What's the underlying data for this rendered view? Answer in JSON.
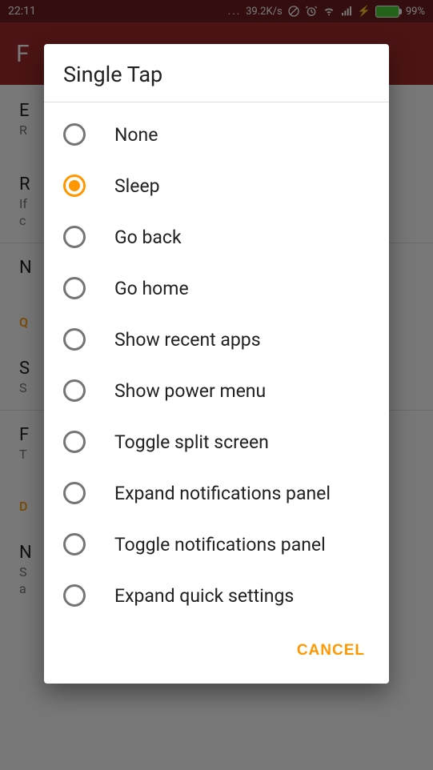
{
  "statusbar": {
    "time": "22:11",
    "net_speed": "39.2K/s",
    "battery_pct": "99%"
  },
  "background": {
    "actionbar_title_initial": "F",
    "rows": [
      {
        "hdr_initial": "E",
        "sub_initial": "R"
      },
      {
        "hdr_initial": "R",
        "sub_initial_line1": "If",
        "sub_initial_line2": "c"
      }
    ],
    "row_n": {
      "hdr_initial": "N"
    },
    "section_q": "Q",
    "row_s": {
      "hdr_initial": "S",
      "sub_initial": "S"
    },
    "row_f": {
      "hdr_initial": "F",
      "sub_initial": "T"
    },
    "section_d": "D",
    "row_bottom": {
      "hdr_initial": "N",
      "sub_initial_line1": "S",
      "sub_initial_line2": "a"
    }
  },
  "dialog": {
    "title": "Single Tap",
    "selected_index": 1,
    "options": [
      "None",
      "Sleep",
      "Go back",
      "Go home",
      "Show recent apps",
      "Show power menu",
      "Toggle split screen",
      "Expand notifications panel",
      "Toggle notifications panel",
      "Expand quick settings"
    ],
    "cancel_label": "CANCEL"
  }
}
